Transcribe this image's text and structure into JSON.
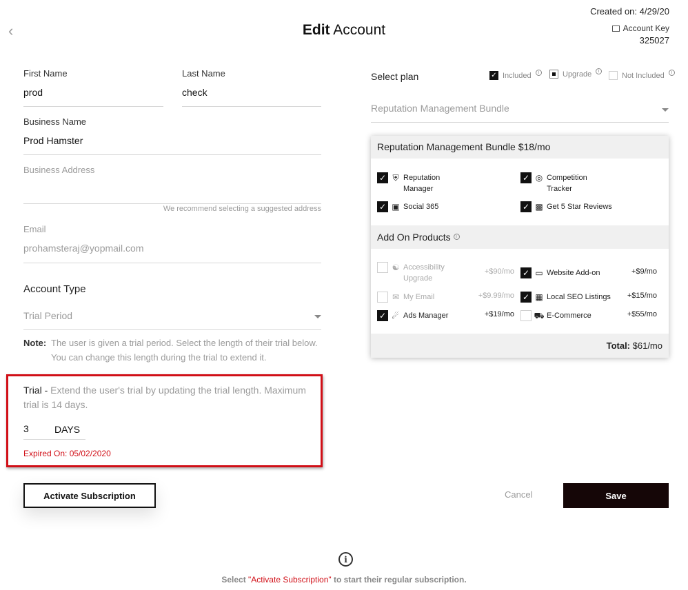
{
  "header": {
    "title_bold": "Edit",
    "title_rest": " Account",
    "created": "Created on: 4/29/20",
    "account_key_label": "Account Key",
    "account_key_value": "325027"
  },
  "form": {
    "first_name_label": "First Name",
    "first_name_value": "prod",
    "last_name_label": "Last Name",
    "last_name_value": "check",
    "business_name_label": "Business Name",
    "business_name_value": "Prod Hamster",
    "business_address_placeholder": "Business Address",
    "address_hint": "We recommend selecting a suggested address",
    "email_label": "Email",
    "email_value": "prohamsteraj@yopmail.com",
    "account_type_label": "Account Type",
    "account_type_value": "Trial Period",
    "note_label": "Note:",
    "note_text": "The user is given a trial period. Select the length of their trial below. You can change this length during the trial to extend it."
  },
  "trial": {
    "label": "Trial -",
    "description": " Extend the user's trial by updating the trial length. Maximum trial is 14 days.",
    "days_value": "3",
    "days_unit": "DAYS",
    "expired": "Expired On: 05/02/2020"
  },
  "buttons": {
    "activate": "Activate Subscription",
    "cancel": "Cancel",
    "save": "Save"
  },
  "plan": {
    "select_label": "Select plan",
    "legend_included": "Included",
    "legend_upgrade": "Upgrade",
    "legend_not_included": "Not Included",
    "selected": "Reputation Management Bundle",
    "card_title": "Reputation Management Bundle $18/mo",
    "features": [
      {
        "label_1": "Reputation",
        "label_2": "Manager",
        "icon": "shield-icon"
      },
      {
        "label_1": "Competition",
        "label_2": "Tracker",
        "icon": "radar-icon"
      },
      {
        "label_1": "Social 365",
        "icon": "calendar-icon"
      },
      {
        "label_1": "Get 5 Star Reviews",
        "icon": "review-card-icon"
      }
    ],
    "addon_title": "Add On Products",
    "addons": [
      {
        "label_1": "Accessibility",
        "label_2": "Upgrade",
        "price": "+$90/mo",
        "checked": false
      },
      {
        "label_1": "Website Add-on",
        "price": "+$9/mo",
        "checked": true
      },
      {
        "label_1": "My Email",
        "price": "+$9.99/mo",
        "checked": false
      },
      {
        "label_1": "Local SEO Listings",
        "price": "+$15/mo",
        "checked": true
      },
      {
        "label_1": "Ads Manager",
        "price": "+$19/mo",
        "checked": true
      },
      {
        "label_1": "E-Commerce",
        "price": "+$55/mo",
        "checked": false
      }
    ],
    "total_label": "Total:",
    "total_value": " $61/mo"
  },
  "footer": {
    "text_pre": "Select ",
    "text_highlight": "\"Activate Subscription\"",
    "text_post": " to start their regular subscription."
  }
}
